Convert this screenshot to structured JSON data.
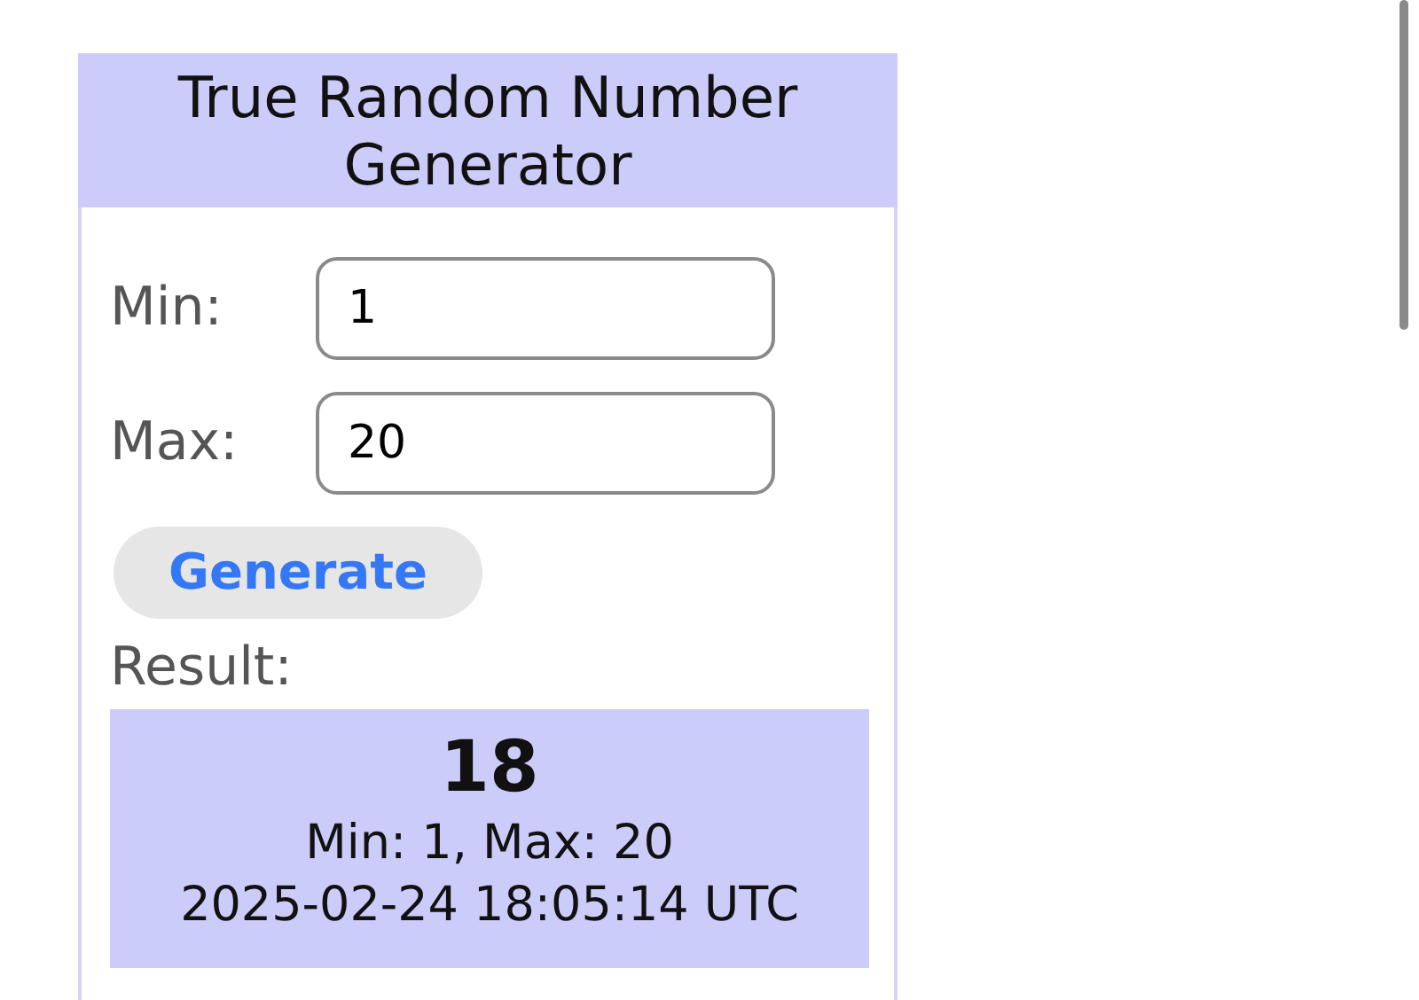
{
  "title": "True Random Number Generator",
  "fields": [
    {
      "label": "Min:",
      "value": "1"
    },
    {
      "label": "Max:",
      "value": "20"
    }
  ],
  "generate_button": "Generate",
  "result_label": "Result:",
  "result": {
    "number": "18",
    "range": "Min: 1, Max: 20",
    "timestamp": "2025-02-24 18:05:14 UTC"
  }
}
